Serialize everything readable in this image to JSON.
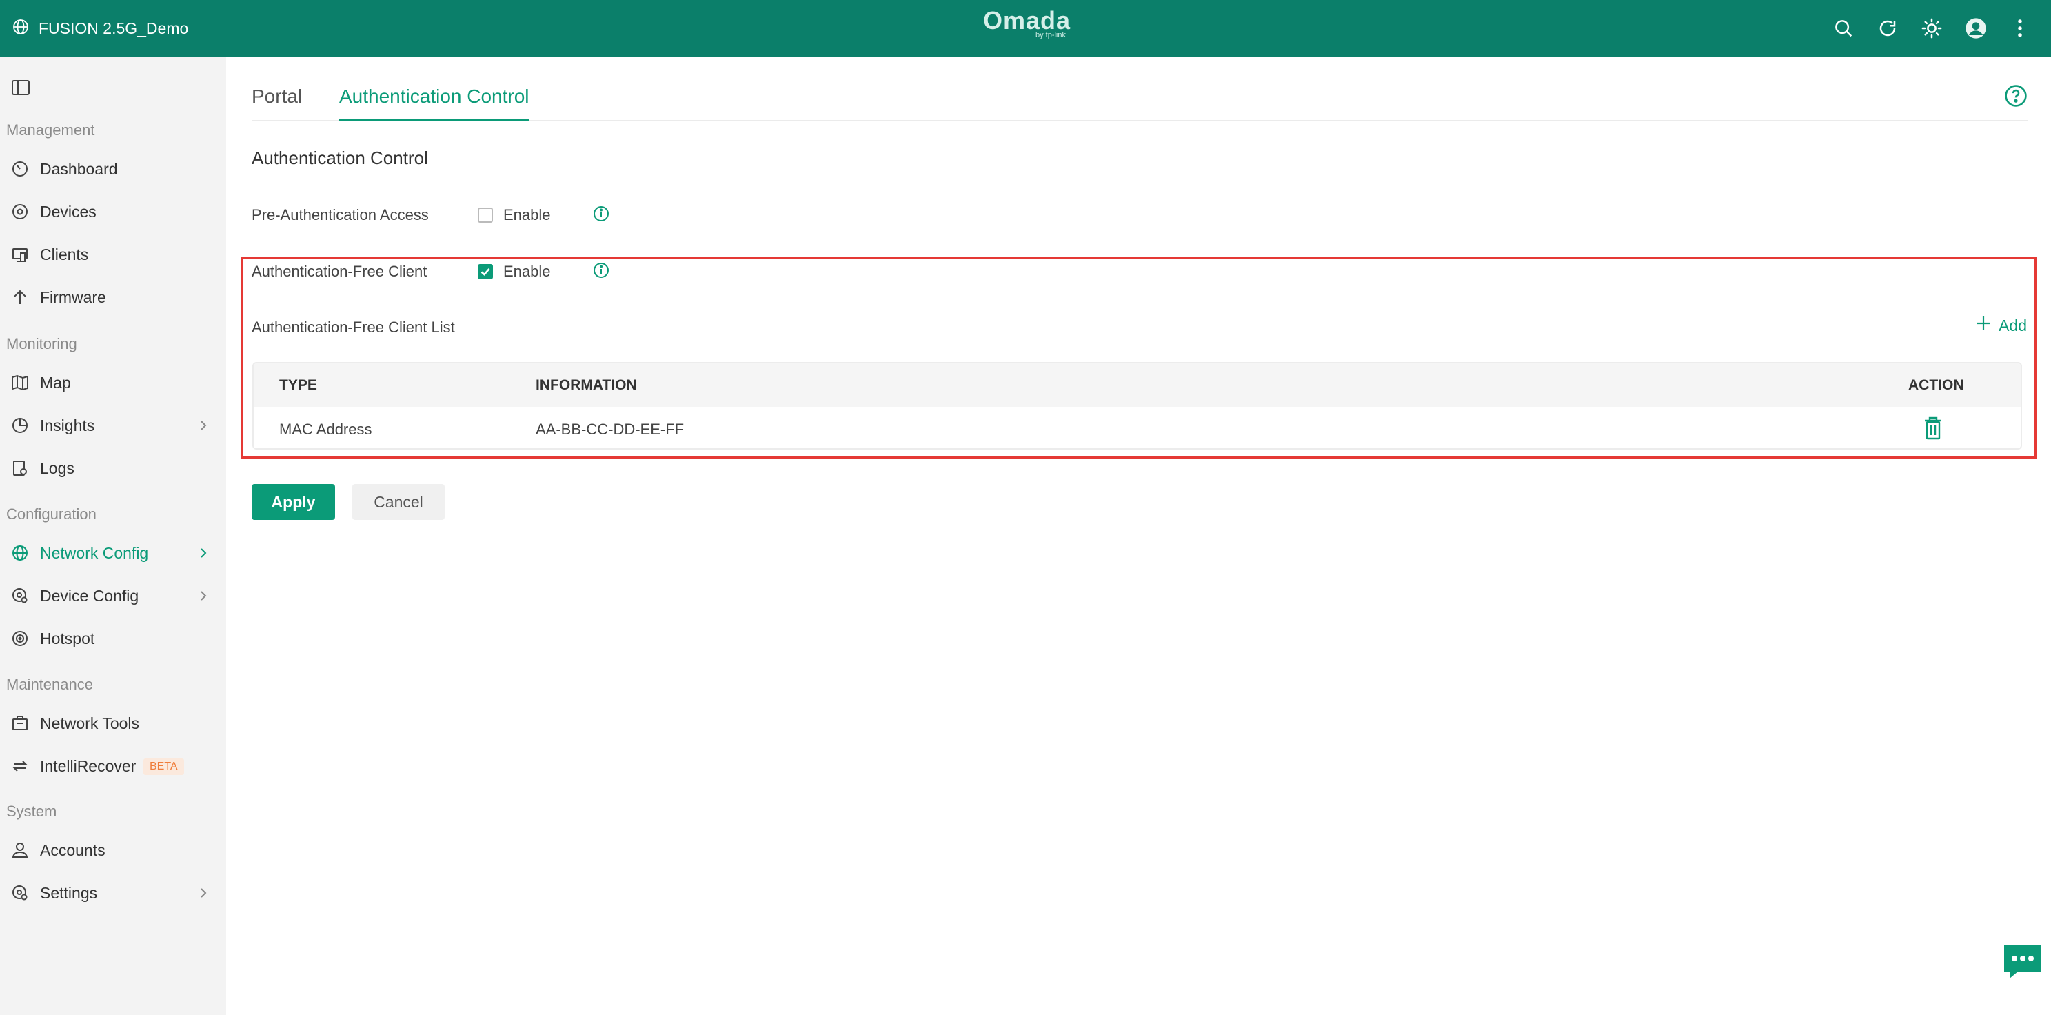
{
  "header": {
    "site_name": "FUSION 2.5G_Demo",
    "brand": "Omada",
    "brand_sub": "by tp-link",
    "icons": [
      "search-icon",
      "refresh-icon",
      "theme-icon",
      "avatar",
      "more-icon"
    ]
  },
  "sidebar": {
    "sections": {
      "management": "Management",
      "monitoring": "Monitoring",
      "configuration": "Configuration",
      "maintenance": "Maintenance",
      "system": "System"
    },
    "items": {
      "dashboard": "Dashboard",
      "devices": "Devices",
      "clients": "Clients",
      "firmware": "Firmware",
      "map": "Map",
      "insights": "Insights",
      "logs": "Logs",
      "network_config": "Network Config",
      "device_config": "Device Config",
      "hotspot": "Hotspot",
      "network_tools": "Network Tools",
      "intellirecover": "IntelliRecover",
      "accounts": "Accounts",
      "settings": "Settings"
    },
    "beta_badge": "BETA",
    "active_item": "Network Config"
  },
  "tabs": {
    "portal": "Portal",
    "auth_control": "Authentication Control",
    "active": "Authentication Control"
  },
  "auth": {
    "section_title": "Authentication Control",
    "pre_auth_label": "Pre-Authentication Access",
    "pre_auth_enabled": false,
    "free_client_label": "Authentication-Free Client",
    "free_client_enabled": true,
    "enable_label": "Enable",
    "list_title": "Authentication-Free Client List",
    "add_label": "Add"
  },
  "table": {
    "columns": {
      "type": "TYPE",
      "information": "INFORMATION",
      "action": "ACTION"
    },
    "rows": [
      {
        "type": "MAC Address",
        "information": "AA-BB-CC-DD-EE-FF"
      }
    ]
  },
  "actions": {
    "apply": "Apply",
    "cancel": "Cancel"
  },
  "colors": {
    "brand": "#0b7f6a",
    "accent": "#0b9b78",
    "highlight": "#e53935",
    "beta": "#ef7d3b"
  }
}
